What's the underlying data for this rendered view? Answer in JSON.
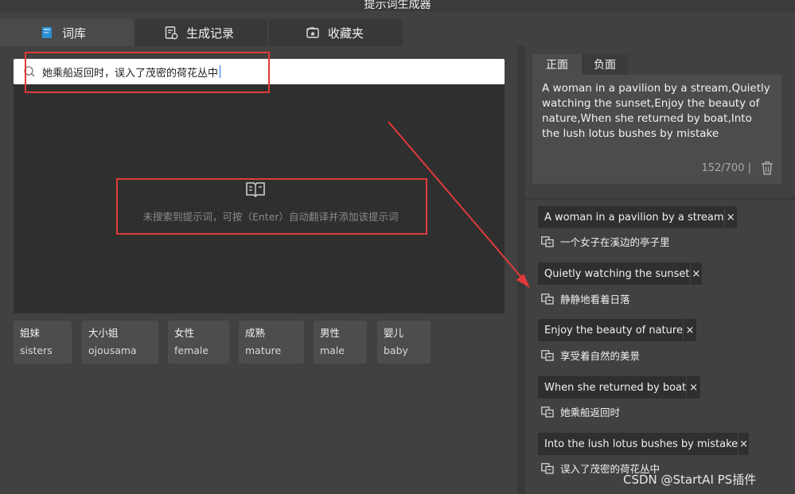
{
  "window": {
    "title": "提示词生成器"
  },
  "tabs": [
    {
      "label": "词库",
      "icon": "book-icon",
      "active": true
    },
    {
      "label": "生成记录",
      "icon": "history-icon",
      "active": false
    },
    {
      "label": "收藏夹",
      "icon": "favorites-icon",
      "active": false
    }
  ],
  "search": {
    "value": "她乘船返回时，误入了茂密的荷花丛中"
  },
  "empty_state": {
    "message": "未搜索到提示词，可按（Enter）自动翻译并添加该提示词"
  },
  "chips": [
    {
      "cn": "姐妹",
      "en": "sisters"
    },
    {
      "cn": "大小姐",
      "en": "ojousama"
    },
    {
      "cn": "女性",
      "en": "female"
    },
    {
      "cn": "成熟",
      "en": "mature"
    },
    {
      "cn": "男性",
      "en": "male"
    },
    {
      "cn": "婴儿",
      "en": "baby"
    }
  ],
  "prompt_tabs": {
    "positive": "正面",
    "negative": "负面"
  },
  "prompt": {
    "text": "A woman in a pavilion by a stream,Quietly watching the sunset,Enjoy the beauty of nature,When she returned by boat,Into the lush lotus bushes by mistake",
    "counter": "152/700 |"
  },
  "tags": [
    {
      "en": "A woman in a pavilion by a stream",
      "cn": "一个女子在溪边的亭子里",
      "remove": "×"
    },
    {
      "en": "Quietly watching the sunset",
      "cn": "静静地看着日落",
      "remove": "×"
    },
    {
      "en": "Enjoy the beauty of nature",
      "cn": "享受着自然的美景",
      "remove": "×"
    },
    {
      "en": "When she returned by boat",
      "cn": "她乘船返回时",
      "remove": "×"
    },
    {
      "en": "Into the lush lotus bushes by mistake",
      "cn": "误入了茂密的荷花丛中",
      "remove": "×"
    }
  ],
  "watermark": "CSDN @StartAI PS插件",
  "colors": {
    "annotation": "#e03a3a",
    "background": "#414141",
    "results_bg": "#2f2f2f",
    "caret": "#1a73e8"
  }
}
